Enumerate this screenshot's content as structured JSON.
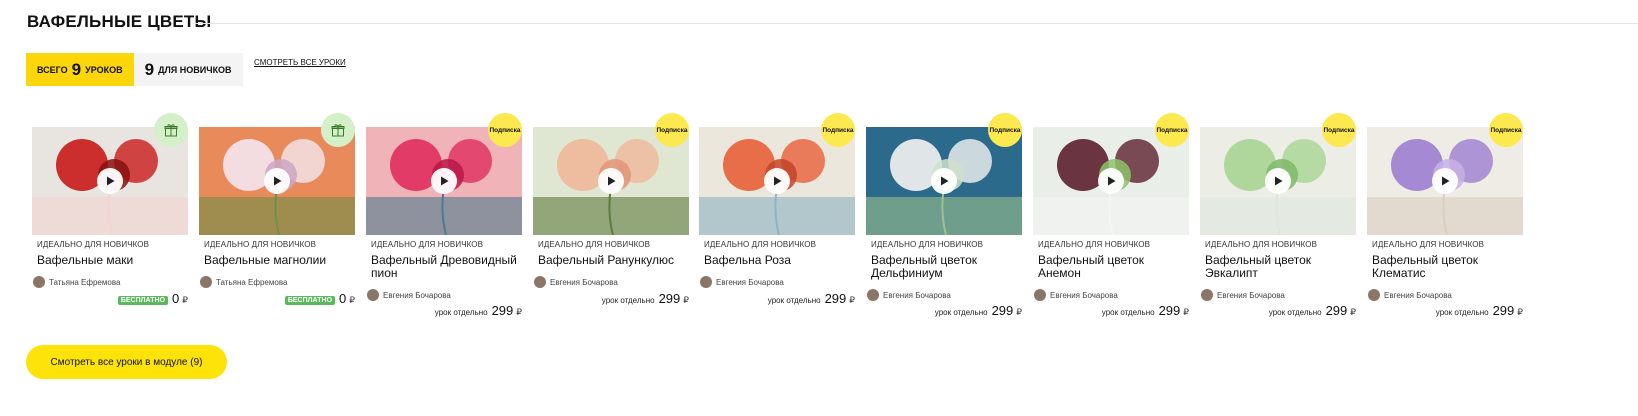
{
  "section": {
    "title": "Вафельные цветы"
  },
  "stats": {
    "total_prefix": "всего",
    "total_count": "9",
    "total_suffix": "уроков",
    "new_count": "9",
    "new_suffix": "для новичков"
  },
  "see_all_link": "смотреть все уроки",
  "cta_label": "Смотреть все уроки в модуле (9)",
  "colors": {
    "accent": "#fde30a",
    "free_badge": "#5cb85c",
    "gift_badge": "#d4f0c8",
    "sub_badge": "#fce84f"
  },
  "cards": [
    {
      "level": "Идеально для новичков",
      "name": "Вафельные маки",
      "author": "Татьяна Ефремова",
      "badge_type": "gift",
      "badge_icon": "gift-icon",
      "price_label": "бесплатно",
      "price": "0",
      "currency": "₽",
      "free": true,
      "palette": [
        "#e8e4e0",
        "#c81a1a",
        "#8a0f0f",
        "#f2d4d0"
      ]
    },
    {
      "level": "Идеально для новичков",
      "name": "Вафельные магнолии",
      "author": "Татьяна Ефремова",
      "badge_type": "gift",
      "badge_icon": "gift-icon",
      "price_label": "бесплатно",
      "price": "0",
      "currency": "₽",
      "free": true,
      "palette": [
        "#e98a5a",
        "#f4e6ef",
        "#c9a7c4",
        "#6e8f4a"
      ]
    },
    {
      "level": "Идеально для новичков",
      "name": "Вафельный Древовидный пион",
      "author": "Евгения Бочарова",
      "badge_type": "sub",
      "badge_label": "Подписка",
      "price_label": "урок отдельно",
      "price": "299",
      "currency": "₽",
      "free": false,
      "palette": [
        "#f0b4b8",
        "#e02e5e",
        "#b81848",
        "#4c7b8c"
      ]
    },
    {
      "level": "Идеально для новичков",
      "name": "Вафельный Ранункулюс",
      "author": "Евгения Бочарова",
      "badge_type": "sub",
      "badge_label": "Подписка",
      "price_label": "урок отдельно",
      "price": "299",
      "currency": "₽",
      "free": false,
      "palette": [
        "#dfe6d2",
        "#f0b89a",
        "#e39478",
        "#5f7b3e"
      ]
    },
    {
      "level": "Идеально для новичков",
      "name": "Вафельна Роза",
      "author": "Евгения Бочарова",
      "badge_type": "sub",
      "badge_label": "Подписка",
      "price_label": "урок отдельно",
      "price": "299",
      "currency": "₽",
      "free": false,
      "palette": [
        "#ece7dc",
        "#e8603a",
        "#c44428",
        "#8bb3c2"
      ]
    },
    {
      "level": "Идеально для новичков",
      "name": "Вафельный цветок Дельфиниум",
      "author": "Евгения Бочарова",
      "badge_type": "sub",
      "badge_label": "Подписка",
      "price_label": "урок отдельно",
      "price": "299",
      "currency": "₽",
      "free": false,
      "palette": [
        "#2c6a8c",
        "#f4f4f2",
        "#cfe0cc",
        "#9ec28e"
      ]
    },
    {
      "level": "Идеально для новичков",
      "name": "Вафельный цветок Анемон",
      "author": "Евгения Бочарова",
      "badge_type": "sub",
      "badge_label": "Подписка",
      "price_label": "урок отдельно",
      "price": "299",
      "currency": "₽",
      "free": false,
      "palette": [
        "#e9eee8",
        "#5c1f2e",
        "#8dc26a",
        "#f5f5f3"
      ]
    },
    {
      "level": "Идеально для новичков",
      "name": "Вафельный цветок Эвкалипт",
      "author": "Евгения Бочарова",
      "badge_type": "sub",
      "badge_label": "Подписка",
      "price_label": "урок отдельно",
      "price": "299",
      "currency": "₽",
      "free": false,
      "palette": [
        "#eceee6",
        "#a8d494",
        "#7eb86a",
        "#dfe6df"
      ]
    },
    {
      "level": "Идеально для новичков",
      "name": "Вафельный цветок Клематис",
      "author": "Евгения Бочарова",
      "badge_type": "sub",
      "badge_label": "Подписка",
      "price_label": "урок отдельно",
      "price": "299",
      "currency": "₽",
      "free": false,
      "palette": [
        "#efece6",
        "#9c7ed0",
        "#c8b2e6",
        "#d9cfc0"
      ]
    }
  ]
}
